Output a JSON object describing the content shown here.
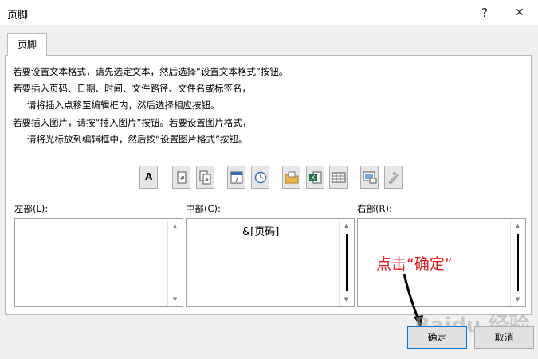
{
  "window": {
    "title": "页脚",
    "help_symbol": "?",
    "close_symbol": "✕"
  },
  "tab": {
    "label": "页脚"
  },
  "instructions": [
    "若要设置文本格式，请先选定文本，然后选择“设置文本格式”按钮。",
    "若要插入页码、日期、时间、文件路径、文件名或标签名，",
    "请将插入点移至编辑框内，然后选择相应按钮。",
    "若要插入图片，请按“插入图片”按钮。若要设置图片格式，",
    "请将光标放到编辑框中，然后按“设置图片格式”按钮。"
  ],
  "toolbar": {
    "format_text_glyph": "A",
    "buttons": [
      "format-text-icon",
      "insert-page-number-icon",
      "insert-page-count-icon",
      "insert-date-icon",
      "insert-time-icon",
      "insert-file-path-icon",
      "insert-file-name-icon",
      "insert-sheet-name-icon",
      "insert-picture-icon",
      "format-picture-icon"
    ]
  },
  "sections": {
    "left": {
      "label_pre": "左部(",
      "label_key": "L",
      "label_post": "):",
      "content": ""
    },
    "center": {
      "label_pre": "中部(",
      "label_key": "C",
      "label_post": "):",
      "content": "&[页码]"
    },
    "right": {
      "label_pre": "右部(",
      "label_key": "R",
      "label_post": "):",
      "content": ""
    }
  },
  "annotation": {
    "text": "点击“确定”",
    "color": "#e02020"
  },
  "buttons": {
    "ok": "确定",
    "cancel": "取消"
  },
  "watermark": {
    "text": "Baidu 经验"
  }
}
